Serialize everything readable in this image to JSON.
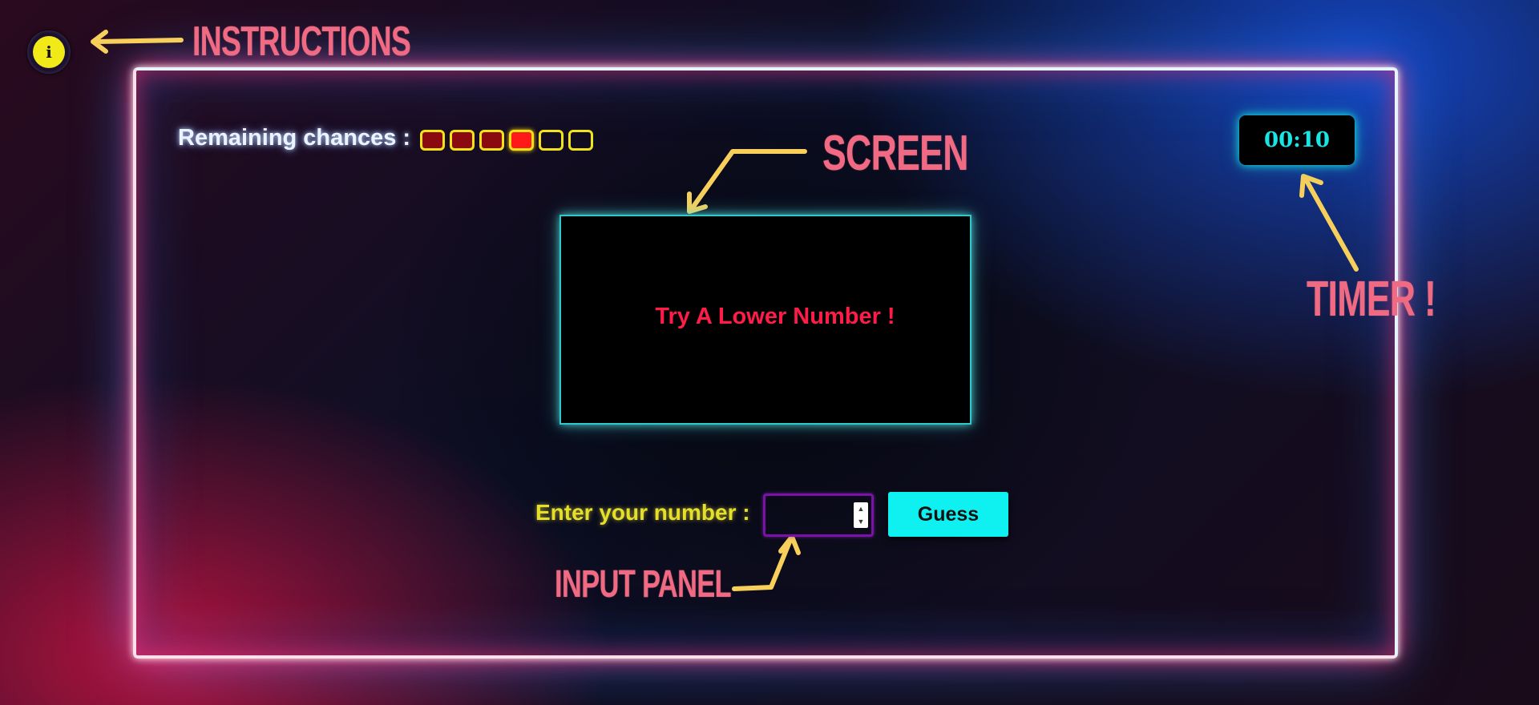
{
  "annotations": {
    "instructions": "INSTRUCTIONS",
    "screen": "SCREEN",
    "timer": "TIMER !",
    "input_panel": "INPUT PANEL"
  },
  "info_button": {
    "icon": "info-icon",
    "glyph": "i"
  },
  "chances": {
    "label": "Remaining chances :",
    "total": 6,
    "used": 3,
    "current_index": 3,
    "colors": {
      "used": "#8a0a10",
      "current": "#ff1a1a",
      "border": "#f2e318"
    }
  },
  "timer": {
    "value": "00:10"
  },
  "screen": {
    "message": "Try A Lower Number !"
  },
  "input_panel": {
    "label": "Enter your number :",
    "value": "",
    "guess_label": "Guess"
  },
  "colors": {
    "accent_cyan": "#0ff0f0",
    "message_red": "#ff1c48",
    "label_yellow": "#e5df2a",
    "annotation_pink": "#f06a83",
    "arrow_yellow": "#f7cf5a"
  }
}
